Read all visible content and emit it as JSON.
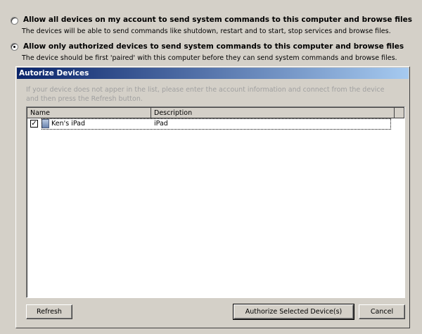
{
  "options": [
    {
      "label": "Allow all devices on my account to send system commands to this computer and browse files",
      "description": "The devices will be able to send commands like shutdown, restart and to start, stop services and browse files.",
      "selected": false
    },
    {
      "label": "Allow only authorized devices to send system commands to this computer and browse files",
      "description": "The device should be first 'paired' with this computer before they can send system commands and browse files.",
      "selected": true
    }
  ],
  "panel": {
    "title": "Autorize Devices",
    "hint": "If your device does not apper in the list, please enter the account information and connect from the device and then press the Refresh button.",
    "columns": [
      "Name",
      "Description"
    ],
    "rows": [
      {
        "name": "Ken's iPad",
        "description": "iPad",
        "checked": true,
        "icon": "device-icon"
      }
    ],
    "buttons": {
      "refresh": "Refresh",
      "authorize": "Authorize Selected Device(s)",
      "cancel": "Cancel"
    }
  }
}
